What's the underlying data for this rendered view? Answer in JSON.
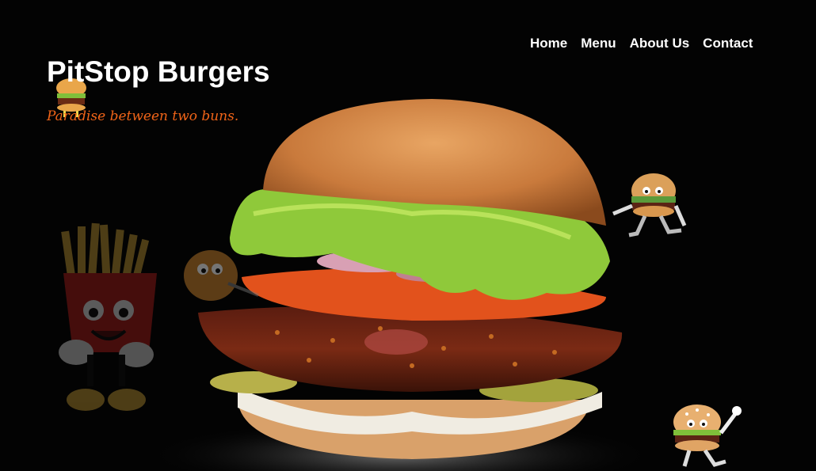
{
  "nav": {
    "items": [
      "Home",
      "Menu",
      "About Us",
      "Contact"
    ]
  },
  "hero": {
    "title": "PitStop Burgers",
    "tagline": "Paradise between two buns."
  },
  "colors": {
    "background": "#030303",
    "accent": "#f06418",
    "text": "#ffffff"
  },
  "images": {
    "hero_burger": "burger-photo",
    "fries_mascot": "fries-mascot",
    "burger_mascots": "burger-mascot"
  }
}
